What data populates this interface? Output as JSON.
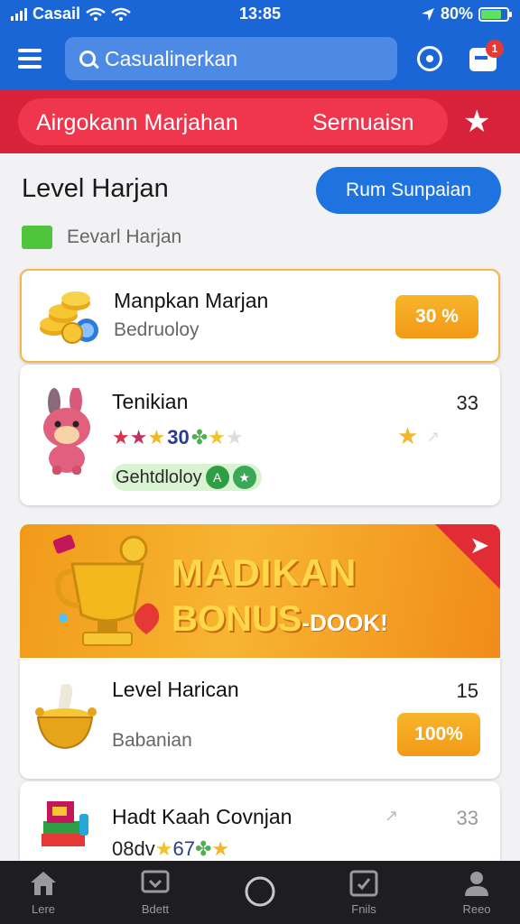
{
  "status_bar": {
    "carrier": "Casail",
    "time": "13:85",
    "battery_pct": "80%"
  },
  "search": {
    "value": "Casualinerkan"
  },
  "notification_count": "1",
  "promo": {
    "left_label": "Airgokann Marjahan",
    "right_label": "Sernuaisn"
  },
  "header": {
    "title": "Level Harjan",
    "cta_label": "Rum Sunpaian",
    "legend_label": "Eevarl Harjan"
  },
  "cards": [
    {
      "title": "Manpkan Marjan",
      "subtitle": "Bedruoloy",
      "badge": "30 %"
    },
    {
      "title": "Tenikian",
      "number": "33",
      "stars_text": "30",
      "tag_label": "Gehtdloloy",
      "tag_icon_text": "A"
    },
    {
      "title": "Level Harican",
      "number": "15",
      "subtitle": "Babanian",
      "badge": "100%"
    },
    {
      "title": "Hadt Kaah Covnjan",
      "number": "33",
      "stars_prefix": "08dv",
      "stars_text": "67"
    }
  ],
  "bonus": {
    "line1": "MADIKAN",
    "line2": "BONUS",
    "line2_suffix": "-DOOK!"
  },
  "nav": [
    {
      "label": "Lere",
      "icon": "home-icon"
    },
    {
      "label": "Bdett",
      "icon": "chat-icon"
    },
    {
      "label": "",
      "icon": "circle-icon"
    },
    {
      "label": "Fnils",
      "icon": "check-square-icon"
    },
    {
      "label": "Reeo",
      "icon": "person-icon"
    }
  ],
  "colors": {
    "primary": "#1a66d6",
    "promo_red": "#d8223c",
    "accent_orange": "#f29a16",
    "legend_green": "#4fc43d",
    "nav_bg": "#1e1e22"
  }
}
